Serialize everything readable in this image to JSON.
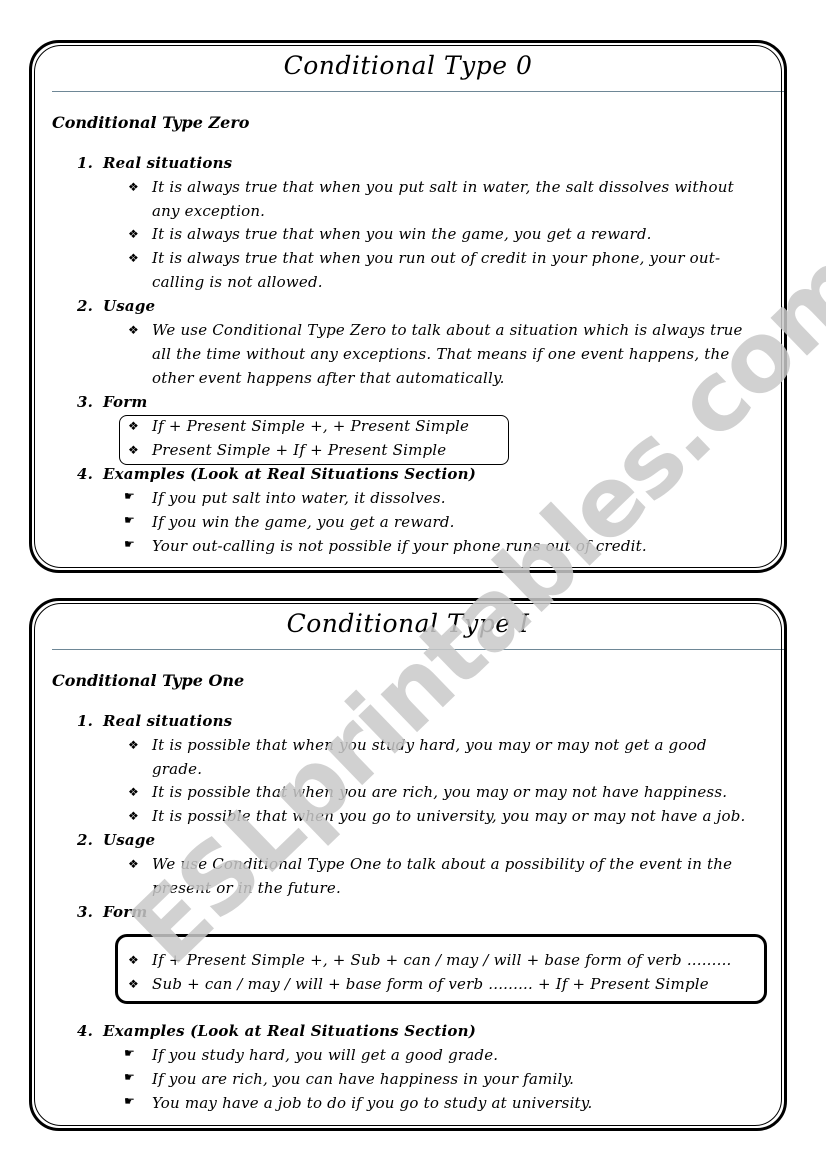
{
  "watermark": "ESLprintables.com",
  "cards": [
    {
      "title": "Conditional Type 0",
      "subtitle": "Conditional Type Zero",
      "sections": {
        "real_situations": {
          "number": "1.",
          "heading": "Real situations",
          "bullet_icon": "diamond-dots",
          "items": [
            [
              "It is always true that when you put salt in water, the salt dissolves without",
              "any exception."
            ],
            [
              "It is always true that when you win the game, you get a reward."
            ],
            [
              "It is always true that when you run out of credit in your phone, your out-",
              "calling is not allowed."
            ]
          ]
        },
        "usage": {
          "number": "2.",
          "heading": "Usage",
          "items": [
            [
              "We use Conditional Type Zero to talk about a situation which is always true",
              "all the time without any exceptions. That means if one event happens, the",
              "other event happens after that automatically."
            ]
          ]
        },
        "form": {
          "number": "3.",
          "heading": "Form",
          "items": [
            "If + Present Simple +, + Present Simple",
            "Present Simple + If + Present Simple"
          ]
        },
        "examples": {
          "number": "4.",
          "heading": "Examples (Look at Real Situations Section)",
          "bullet_icon": "pointing-hand",
          "items": [
            "If you put salt into water, it dissolves.",
            "If you win the game, you get a reward.",
            "Your out-calling is not possible if your phone runs out of credit."
          ]
        }
      }
    },
    {
      "title": "Conditional Type I",
      "subtitle": "Conditional Type One",
      "sections": {
        "real_situations": {
          "number": "1.",
          "heading": "Real situations",
          "bullet_icon": "diamond-dots",
          "items": [
            [
              "It is possible that when you study hard, you may or may not get a good",
              "grade."
            ],
            [
              "It is possible that when you are rich, you may or may not have happiness."
            ],
            [
              "It is possible that when you go to university, you may or may not have a job."
            ]
          ]
        },
        "usage": {
          "number": "2.",
          "heading": "Usage",
          "items": [
            [
              "We use Conditional Type One to talk about a possibility of the event in the",
              "present or in the future."
            ]
          ]
        },
        "form": {
          "number": "3.",
          "heading": "Form",
          "items": [
            "If + Present Simple +, + Sub + can / may / will + base form of verb .........",
            "Sub + can / may / will + base form of verb ......... + If + Present Simple"
          ]
        },
        "examples": {
          "number": "4.",
          "heading": "Examples (Look at Real Situations Section)",
          "bullet_icon": "pointing-hand",
          "items": [
            "If you study hard, you will get a good grade.",
            "If you are rich, you can have happiness in your family.",
            "You may have a job to do if you go to study at university."
          ]
        }
      }
    }
  ],
  "glyphs": {
    "diamond_bullet": "❖",
    "hand_bullet": "☛"
  }
}
